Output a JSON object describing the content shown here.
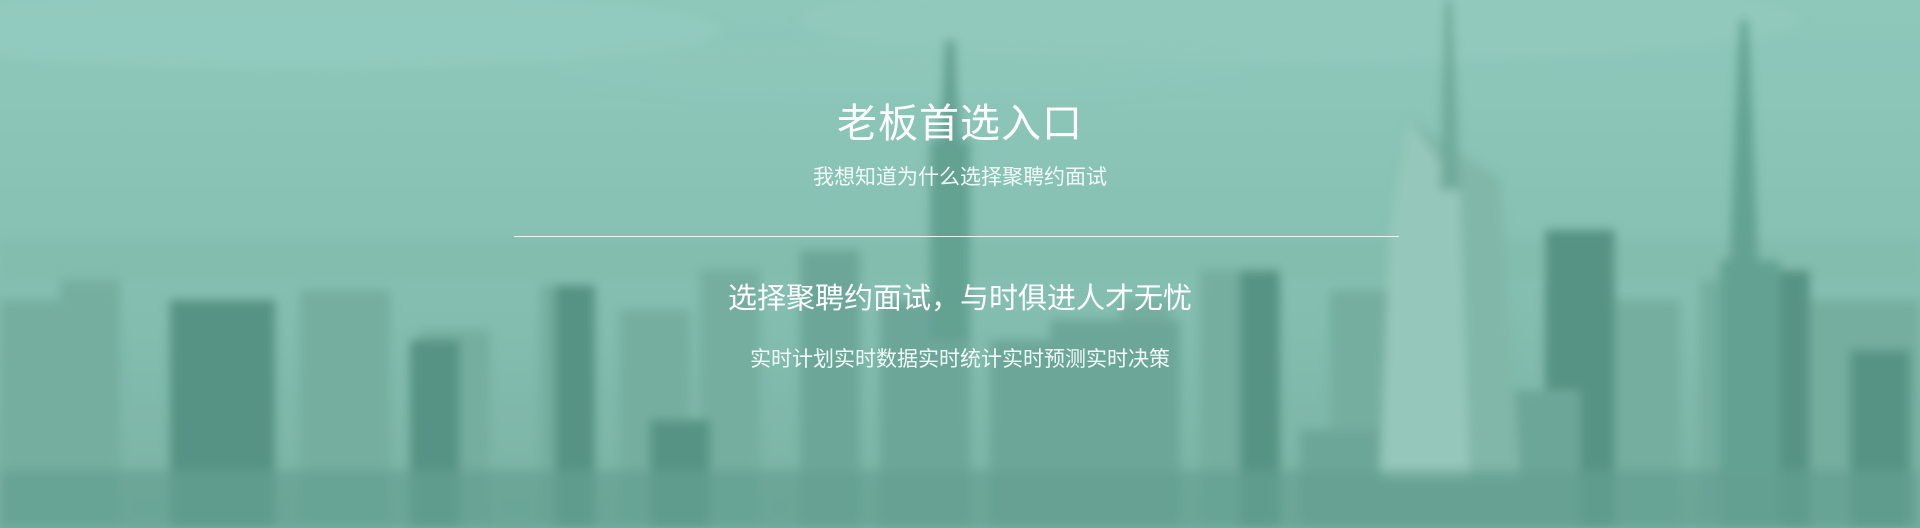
{
  "hero": {
    "title": "老板首选入口",
    "subtitle": "我想知道为什么选择聚聘约面试",
    "headline": "选择聚聘约面试，与时俱进人才无忧",
    "tagline": "实时计划实时数据实时统计实时预测实时决策"
  },
  "background": {
    "description_icon": "city-skyline-icon",
    "tint_color": "#86c1b4",
    "text_color": "#ffffff"
  }
}
